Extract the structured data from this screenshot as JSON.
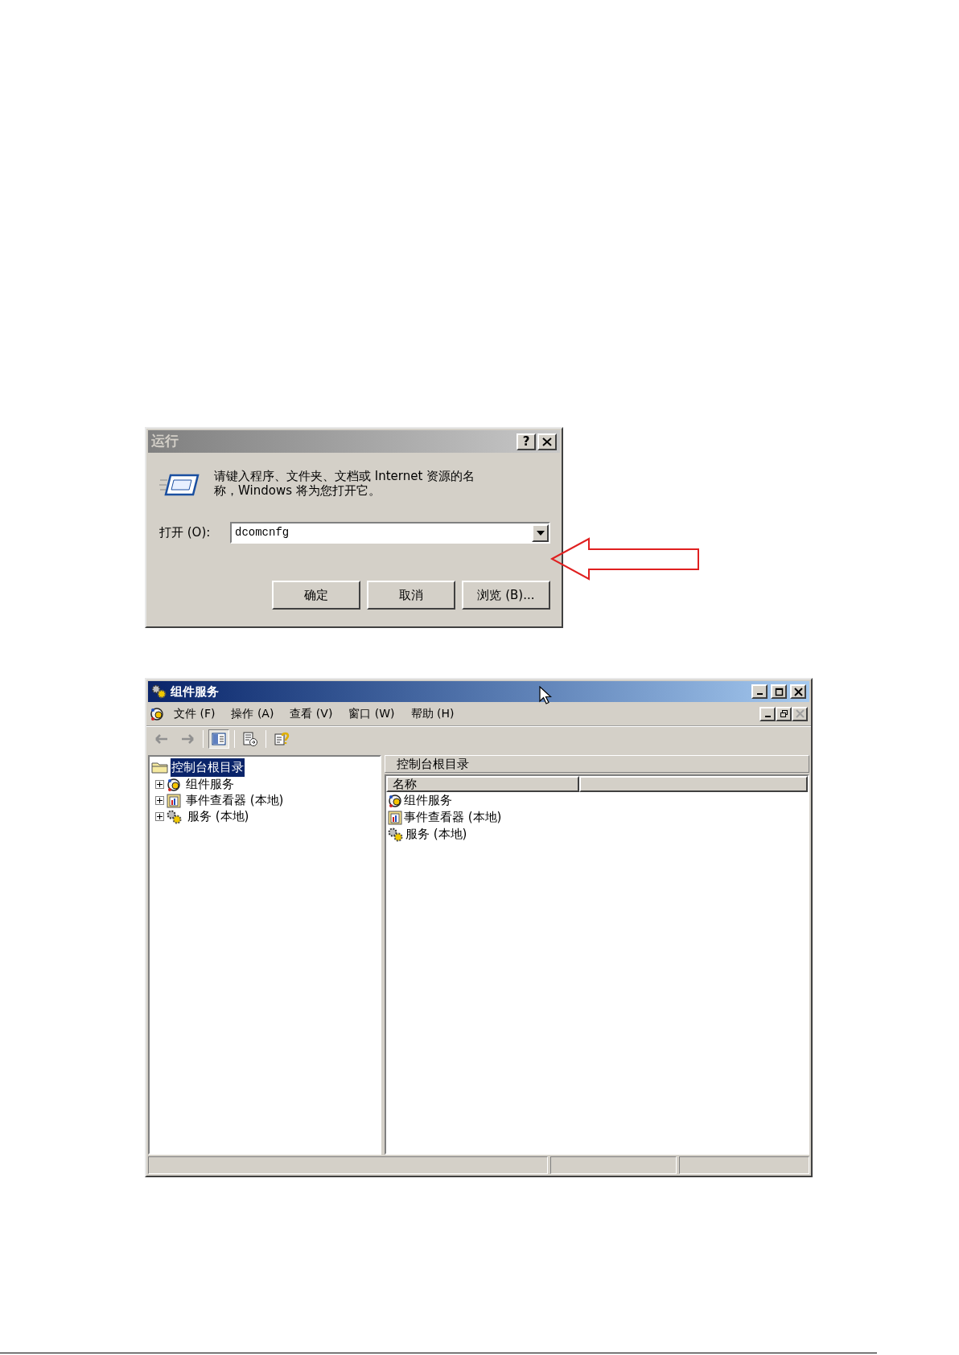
{
  "run_dialog": {
    "title": "运行",
    "help_button": "?",
    "prompt": "请键入程序、文件夹、文档或 Internet 资源的名称，Windows 将为您打开它。",
    "open_label": "打开 (O):",
    "command": "dcomcnfg",
    "buttons": [
      "确定",
      "取消",
      "浏览 (B)..."
    ]
  },
  "component_services": {
    "title": "组件服务",
    "menu": [
      "文件 (F)",
      "操作 (A)",
      "查看 (V)",
      "窗口 (W)",
      "帮助 (H)"
    ],
    "tree": {
      "label": "控制台根目录",
      "selected": true,
      "children": [
        {
          "label": "组件服务",
          "kind": "component",
          "expanded": false
        },
        {
          "label": "事件查看器 (本地)",
          "kind": "event",
          "expanded": false
        },
        {
          "label": "服务 (本地)",
          "kind": "service",
          "expanded": false
        }
      ]
    },
    "right_pane": {
      "header": "控制台根目录",
      "columns": [
        "名称"
      ],
      "rows": [
        {
          "name": "组件服务",
          "kind": "component"
        },
        {
          "name": "事件查看器 (本地)",
          "kind": "event"
        },
        {
          "name": "服务 (本地)",
          "kind": "service"
        }
      ]
    }
  }
}
